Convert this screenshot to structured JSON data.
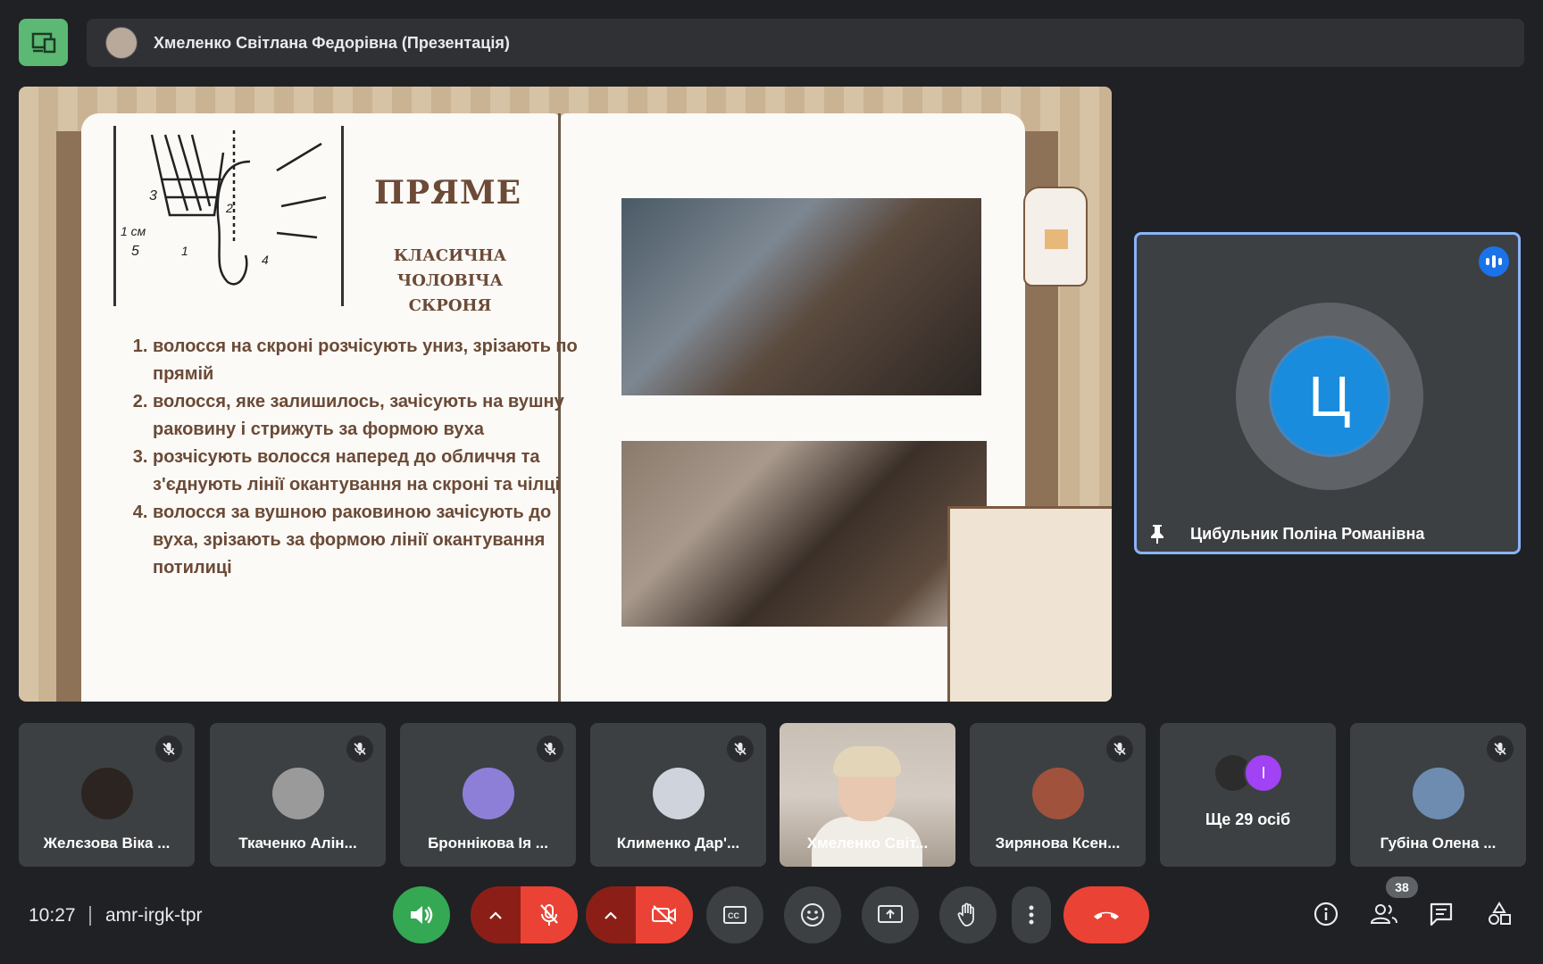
{
  "header": {
    "presenter_title": "Хмеленко Світлана Федорівна (Презентація)",
    "presenter_initial": ""
  },
  "slide": {
    "heading": "ПРЯМЕ",
    "subheading": "КЛАСИЧНА ЧОЛОВІЧА СКРОНЯ",
    "steps": [
      "волосся на скроні розчісують униз, зрізають по прямій",
      "волосся, яке залишилось, зачісують на вушну раковину і стрижуть за формою вуха",
      "розчісують волосся наперед до обличчя та з'єднують лінії окантування на скроні та чілці",
      "волосся за вушною раковиною зачісують до вуха, зрізають за формою лінії окантування потилиці"
    ],
    "diagram_labels": [
      "3",
      "1 см",
      "5",
      "1",
      "2",
      "4"
    ]
  },
  "pinned": {
    "initial": "Ц",
    "name": "Цибульник Поліна Романівна"
  },
  "participants": [
    {
      "name": "Желєзова Віка ...",
      "muted": true
    },
    {
      "name": "Ткаченко Алін...",
      "muted": true
    },
    {
      "name": "Броннікова Ія ...",
      "muted": true
    },
    {
      "name": "Клименко Дар'...",
      "muted": true
    },
    {
      "name": "Хмеленко Світ...",
      "muted": false
    },
    {
      "name": "Зирянова Ксен...",
      "muted": true
    },
    {
      "more_label": "Ще 29 осіб",
      "initial": "І"
    },
    {
      "name": "Губіна Олена ...",
      "muted": true
    }
  ],
  "bottom": {
    "time": "10:27",
    "meeting_code": "amr-irgk-tpr",
    "participant_count": "38"
  },
  "colors": {
    "accent_blue": "#8ab4f8",
    "green": "#34a853",
    "red": "#ea4335",
    "present_green": "#5bb974"
  }
}
